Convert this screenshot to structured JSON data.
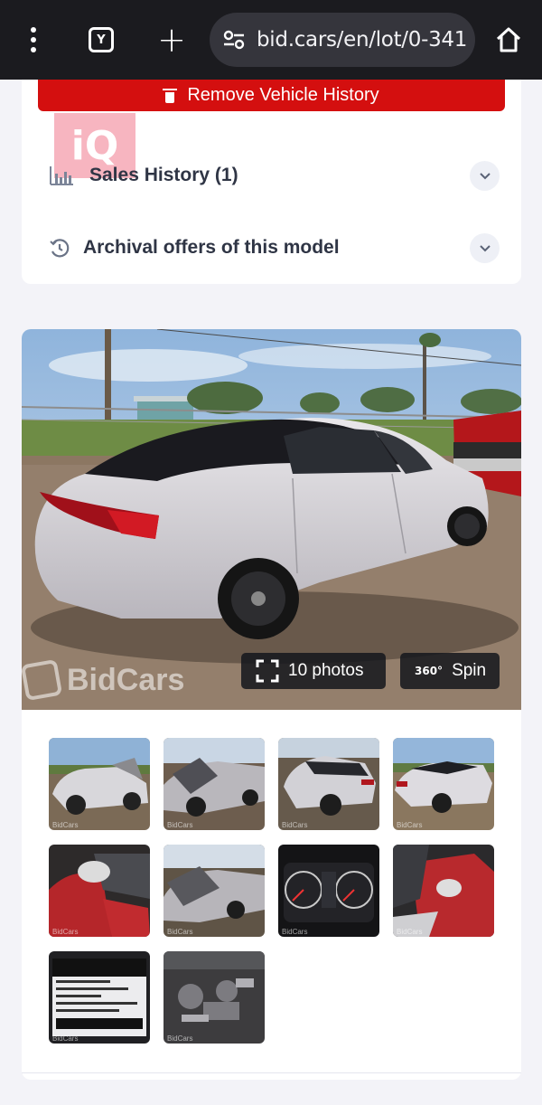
{
  "browser": {
    "url": "bid.cars/en/lot/0-341",
    "tab_count": "Y"
  },
  "vehicle_card": {
    "remove_history_label": "Remove Vehicle History",
    "watermark_text": "iQ",
    "sales_history_label": "Sales History (1)",
    "archival_offers_label": "Archival offers of this model"
  },
  "gallery": {
    "photos_button_label": "10 photos",
    "spin_badge": "360°",
    "spin_button_label": "Spin",
    "watermark": "BidCars",
    "thumbnail_watermark": "BidCars",
    "thumbnails": [
      {
        "subject": "car-front-right-damaged"
      },
      {
        "subject": "car-front-damage-closeup"
      },
      {
        "subject": "car-rear-left"
      },
      {
        "subject": "car-rear-right"
      },
      {
        "subject": "interior-driver-seat"
      },
      {
        "subject": "engine-bay-damage"
      },
      {
        "subject": "instrument-cluster"
      },
      {
        "subject": "interior-rear-seats"
      },
      {
        "subject": "vin-label"
      },
      {
        "subject": "engine-compartment"
      }
    ]
  },
  "colors": {
    "accent_red": "#d40f0f",
    "browser_bar": "#1b1b1f",
    "url_pill": "#35353c",
    "page_bg": "#f3f3f8",
    "text_dark": "#2f3545"
  }
}
